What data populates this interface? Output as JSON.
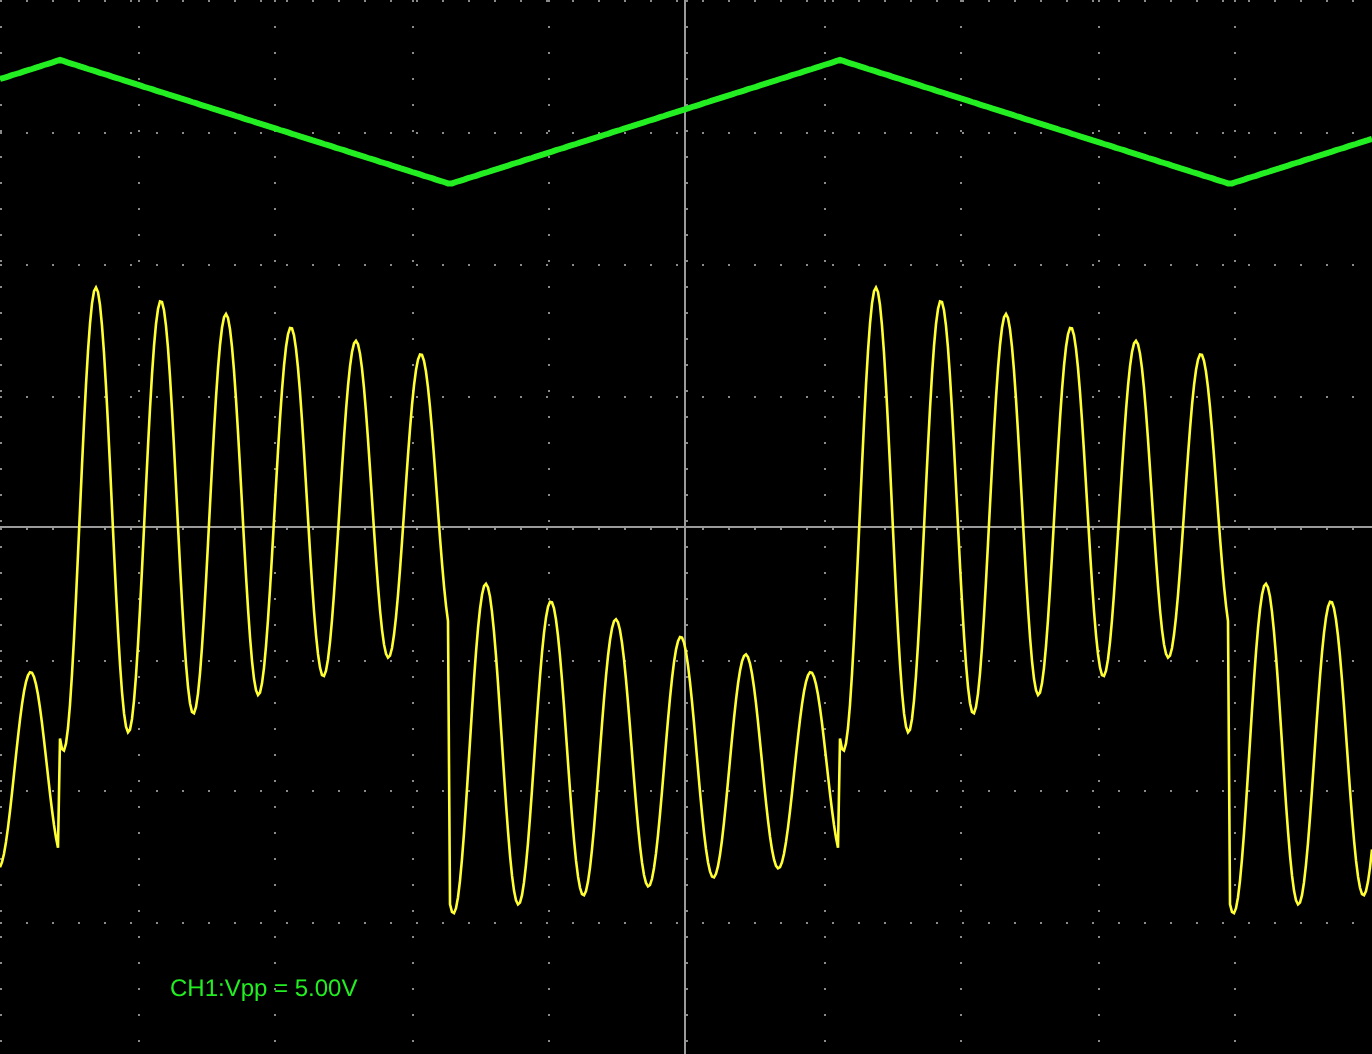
{
  "measurement": {
    "text": "CH1:Vpp = 5.00V"
  }
}
